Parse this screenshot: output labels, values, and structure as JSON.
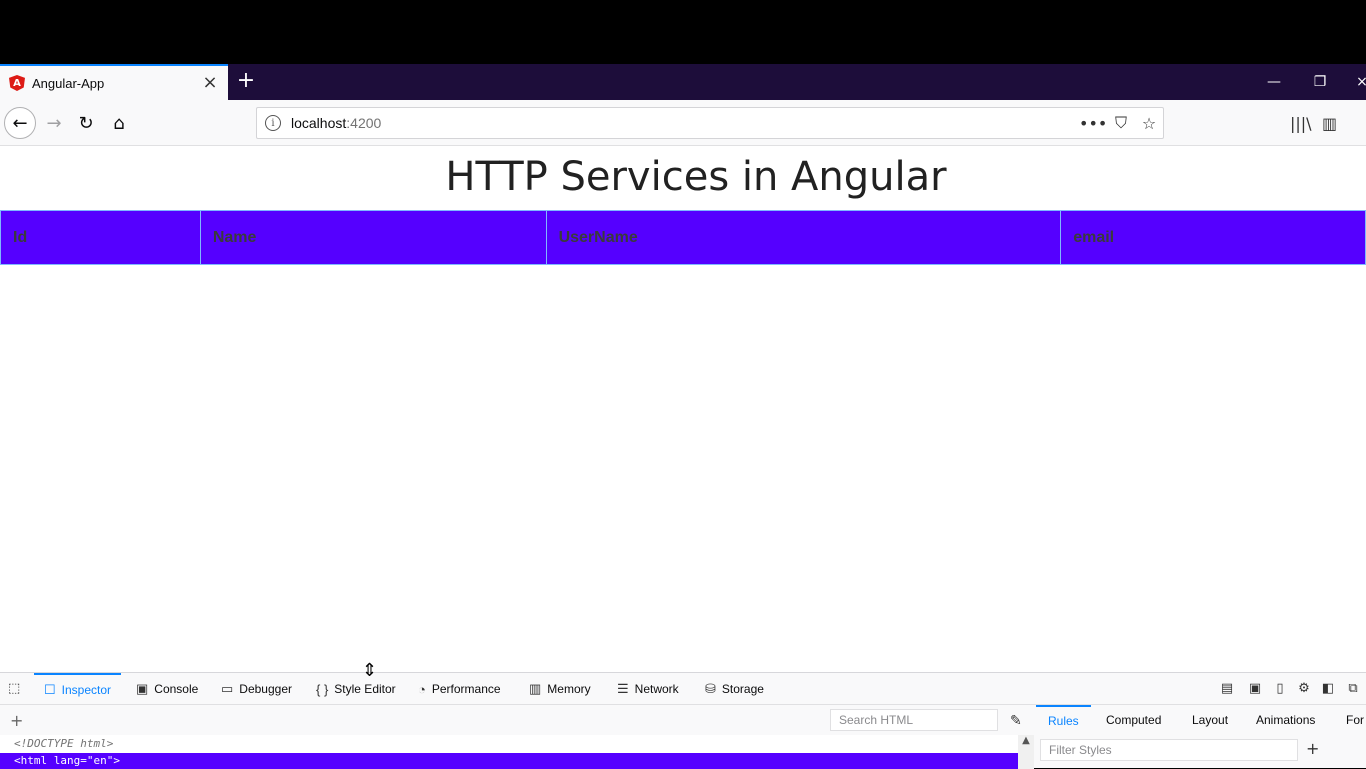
{
  "browser": {
    "tab": {
      "title": "Angular-App",
      "favicon_letter": "A",
      "close": "×"
    },
    "new_tab": "+",
    "window_controls": {
      "minimize": "—",
      "restore": "❐",
      "close": "×"
    },
    "nav": {
      "back": "←",
      "forward": "→",
      "reload": "↻",
      "home": "⌂"
    },
    "url": {
      "host": "localhost",
      "port": ":4200",
      "info": "i",
      "more": "•••",
      "pocket": "⛉",
      "bookmark": "☆"
    },
    "toolbar_right": {
      "library": "|||\\",
      "sidebar": "▥"
    }
  },
  "page": {
    "title": "HTTP Services in Angular",
    "table": {
      "headers": [
        "Id",
        "Name",
        "UserName",
        "email"
      ]
    },
    "colors": {
      "header_bg": "#5500ff"
    }
  },
  "devtools": {
    "tabs": [
      {
        "label": "Inspector",
        "icon": "☐"
      },
      {
        "label": "Console",
        "icon": "▣"
      },
      {
        "label": "Debugger",
        "icon": "▭"
      },
      {
        "label": "Style Editor",
        "icon": "{ }"
      },
      {
        "label": "Performance",
        "icon": "◔"
      },
      {
        "label": "Memory",
        "icon": "▥"
      },
      {
        "label": "Network",
        "icon": "☰"
      },
      {
        "label": "Storage",
        "icon": "⛁"
      }
    ],
    "search_html_placeholder": "Search HTML",
    "side_tabs": [
      "Rules",
      "Computed",
      "Layout",
      "Animations",
      "For"
    ],
    "filter_styles_placeholder": "Filter Styles",
    "markup": {
      "doctype": "<!DOCTYPE html>",
      "html_line": "<html lang=\"en\">"
    }
  }
}
